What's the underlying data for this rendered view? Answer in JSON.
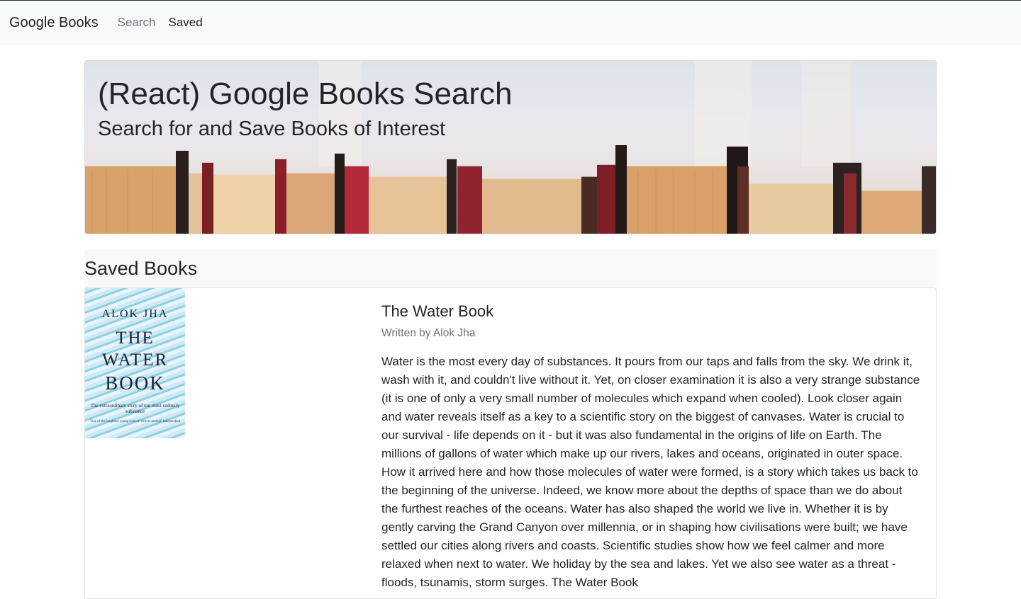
{
  "nav": {
    "brand": "Google Books",
    "links": [
      {
        "label": "Search",
        "active": false
      },
      {
        "label": "Saved",
        "active": true
      }
    ]
  },
  "hero": {
    "title": "(React) Google Books Search",
    "subtitle": "Search for and Save Books of Interest"
  },
  "saved": {
    "heading": "Saved Books",
    "books": [
      {
        "title": "The Water Book",
        "author": "Written by Alok Jha",
        "cover": {
          "author": "ALOK JHA",
          "line1": "THE",
          "line2": "WATER",
          "line3": "BOOK",
          "tagline": "The extraordinary story of our most ordinary substance",
          "quote": "'One of the brightest young science writers around' Independent"
        },
        "description": "Water is the most every day of substances. It pours from our taps and falls from the sky. We drink it, wash with it, and couldn't live without it. Yet, on closer examination it is also a very strange substance (it is one of only a very small number of molecules which expand when cooled). Look closer again and water reveals itself as a key to a scientific story on the biggest of canvases. Water is crucial to our survival - life depends on it - but it was also fundamental in the origins of life on Earth. The millions of gallons of water which make up our rivers, lakes and oceans, originated in outer space. How it arrived here and how those molecules of water were formed, is a story which takes us back to the beginning of the universe. Indeed, we know more about the depths of space than we do about the furthest reaches of the oceans. Water has also shaped the world we live in. Whether it is by gently carving the Grand Canyon over millennia, or in shaping how civilisations were built; we have settled our cities along rivers and coasts. Scientific studies show how we feel calmer and more relaxed when next to water. We holiday by the sea and lakes. Yet we also see water as a threat - floods, tsunamis, storm surges. The Water Book"
      }
    ]
  },
  "colors": {
    "navbar_bg": "#f8f9fa",
    "muted_text": "#6c757d",
    "text": "#212529"
  }
}
